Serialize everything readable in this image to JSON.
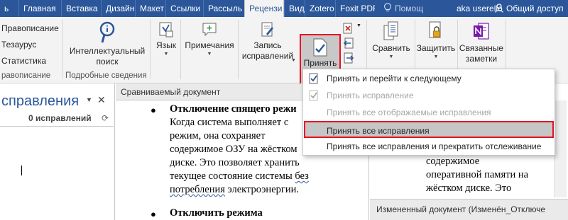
{
  "tabs": {
    "t0": "ь",
    "t1": "Главная",
    "t2": "Вставка",
    "t3": "Дизайн",
    "t4": "Макет",
    "t5": "Ссылки",
    "t6": "Рассыль",
    "t7": "Рецензи",
    "t8": "Вид",
    "t9": "Zotero",
    "t10": "Foxit PDF"
  },
  "tell_me": "Помощ",
  "user_name": "aka userello",
  "share_label": "Общий доступ",
  "ribbon": {
    "spelling": "Правописание",
    "thesaurus": "Тезаурус",
    "stats": "Статистика",
    "proofing_group": "равописание",
    "smart_lookup_1": "Интеллектуальный",
    "smart_lookup_2": "поиск",
    "insights_group": "Подробные сведения",
    "language": "Язык",
    "comments": "Примечания",
    "track_1": "Запись",
    "track_2": "исправлений",
    "accept": "Принять",
    "compare": "Сравнить",
    "protect": "Защитить",
    "linked_1": "Связанные",
    "linked_2": "заметки"
  },
  "left_pane": {
    "title": "справления",
    "count": "0 исправлений"
  },
  "compared_doc": {
    "header": "Сравниваемый документ",
    "lines": {
      "l1": "Отключение спящего режи",
      "l2": "Когда система выполняет с",
      "l3": "режим, она сохраняет",
      "l4": "содержимое ОЗУ на жёстком",
      "l5": "диске. Это позволяет хранить",
      "l6a": "текущее состояние системы ",
      "l6b": "без",
      "l7a": "потребления",
      "l7b": " электроэнергии.",
      "l8": "Отключить режима"
    }
  },
  "right_pane": {
    "lines": {
      "r1": "содержимое",
      "r2": "оперативной памяти на",
      "r3": "жёстком диске. Это"
    },
    "changed_header": "Измененный документ (Изменён_Отключе"
  },
  "menu": {
    "m1": "Принять и перейти к следующему",
    "m2": "Принять исправление",
    "m3": "Принять все отображаемые исправления",
    "m4": "Принять все исправления",
    "m5": "Принять все исправления и прекратить отслеживание"
  },
  "colors": {
    "titlebar": "#2b579a",
    "ribbon": "#f3f3f3",
    "highlight_border": "#e81123",
    "accent": "#2b579a"
  },
  "icons": {
    "search": "search-icon",
    "language": "language-icon",
    "comment": "comment-icon",
    "track_changes": "track-changes-icon",
    "accept": "accept-check-icon",
    "compare": "compare-icon",
    "protect": "lock-icon",
    "onenote": "onenote-icon"
  }
}
